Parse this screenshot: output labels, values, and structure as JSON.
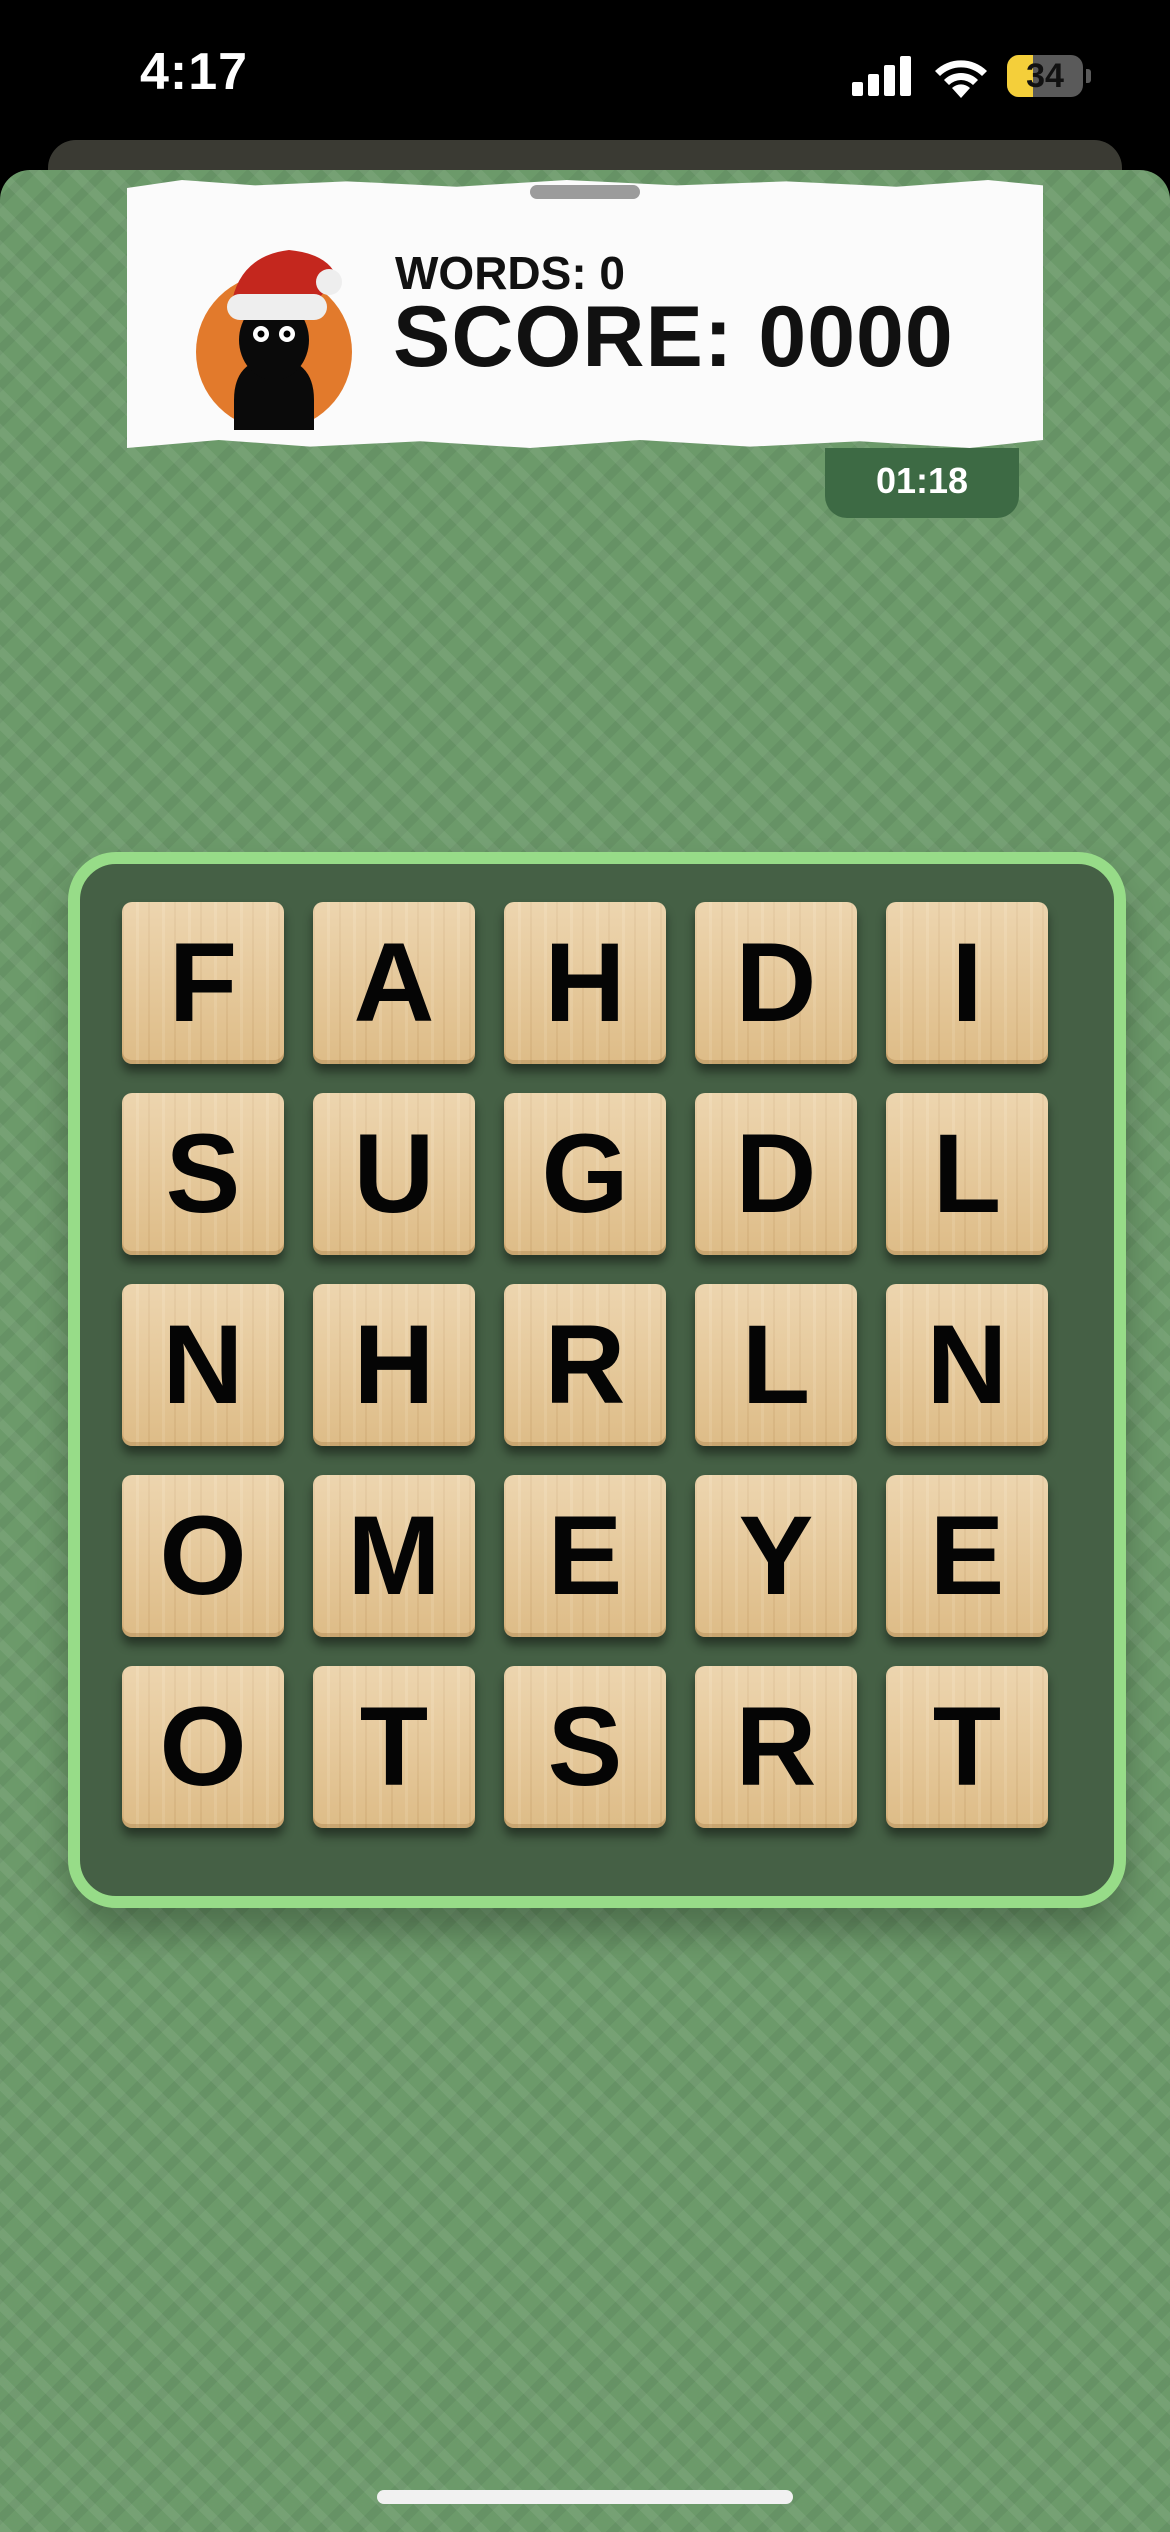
{
  "status_bar": {
    "time": "4:17",
    "battery_level": "34",
    "battery_fraction": 0.34,
    "signal_bars": 4,
    "icons": [
      "signal-icon",
      "wifi-icon",
      "battery-icon"
    ]
  },
  "header": {
    "words_label": "WORDS: 0",
    "score_label": "SCORE: 0000",
    "avatar": "santa-hat-avatar"
  },
  "timer": {
    "value": "01:18"
  },
  "board": {
    "rows": [
      [
        "F",
        "A",
        "H",
        "D",
        "I"
      ],
      [
        "S",
        "U",
        "G",
        "D",
        "L"
      ],
      [
        "N",
        "H",
        "R",
        "L",
        "N"
      ],
      [
        "O",
        "M",
        "E",
        "Y",
        "E"
      ],
      [
        "O",
        "T",
        "S",
        "R",
        "T"
      ]
    ]
  },
  "colors": {
    "background": "#6c9a6a",
    "board_border": "#97dc88",
    "board_fill": "#456045",
    "timer_fill": "#3d6a44",
    "tile": "#e6c590",
    "battery_fill": "#f4cf3a",
    "avatar_circle": "#e27a2c",
    "santa_hat": "#c4271e"
  }
}
